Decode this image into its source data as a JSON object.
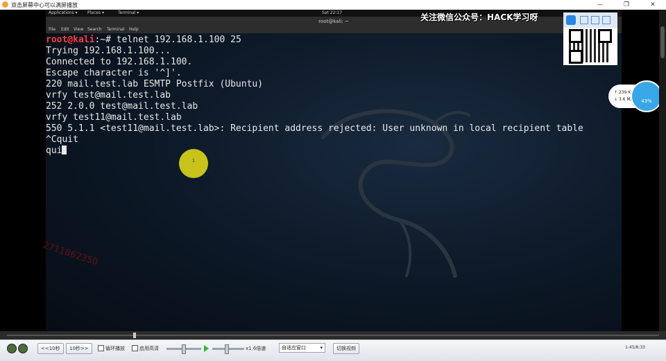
{
  "player": {
    "title": "双击屏幕中心可以满屏播放",
    "win_min": "—",
    "win_max": "❐",
    "win_close": "✕"
  },
  "gnome": {
    "applications": "Applications ▾",
    "places": "Places ▾",
    "terminal": "Terminal ▾",
    "clock": "Sat 22:17"
  },
  "terminal": {
    "title": "root@kali: ~",
    "menu": [
      "File",
      "Edit",
      "View",
      "Search",
      "Terminal",
      "Help"
    ],
    "prompt_user": "root@kali",
    "prompt_rest": ":~# telnet 192.168.1.100 25",
    "lines": [
      "Trying 192.168.1.100...",
      "Connected to 192.168.1.100.",
      "Escape character is '^]'.",
      "220 mail.test.lab ESMTP Postfix (Ubuntu)",
      "vrfy test@mail.test.lab",
      "252 2.0.0 test@mail.test.lab",
      "vrfy test11@mail.test.lab",
      "550 5.1.1 <test11@mail.test.lab>: Recipient address rejected: User unknown in local recipient table",
      "^Cquit"
    ],
    "current_input": "qui"
  },
  "overlay": {
    "follow_text": "关注微信公众号：HACK学习呀",
    "watermark": "2711862350",
    "cursor_marker": "1"
  },
  "side_widget": {
    "up": "↑ 239 K/s",
    "down": "↓ 3.6 M/s",
    "percent": "43%"
  },
  "controls": {
    "back": "<<10秒",
    "forward": "10秒>>",
    "loop_label": "循环播放",
    "hd_label": "启用高清",
    "speed_label": "x1.6倍速",
    "fit_option": "自适应窗口",
    "switch": "切换视频",
    "time": "1:45/8:33"
  },
  "colors": {
    "prompt_red": "#ff3b3b",
    "terminal_text": "#e8e8e8",
    "marker_yellow": "#d8d21a",
    "play_green": "#2db92d"
  }
}
